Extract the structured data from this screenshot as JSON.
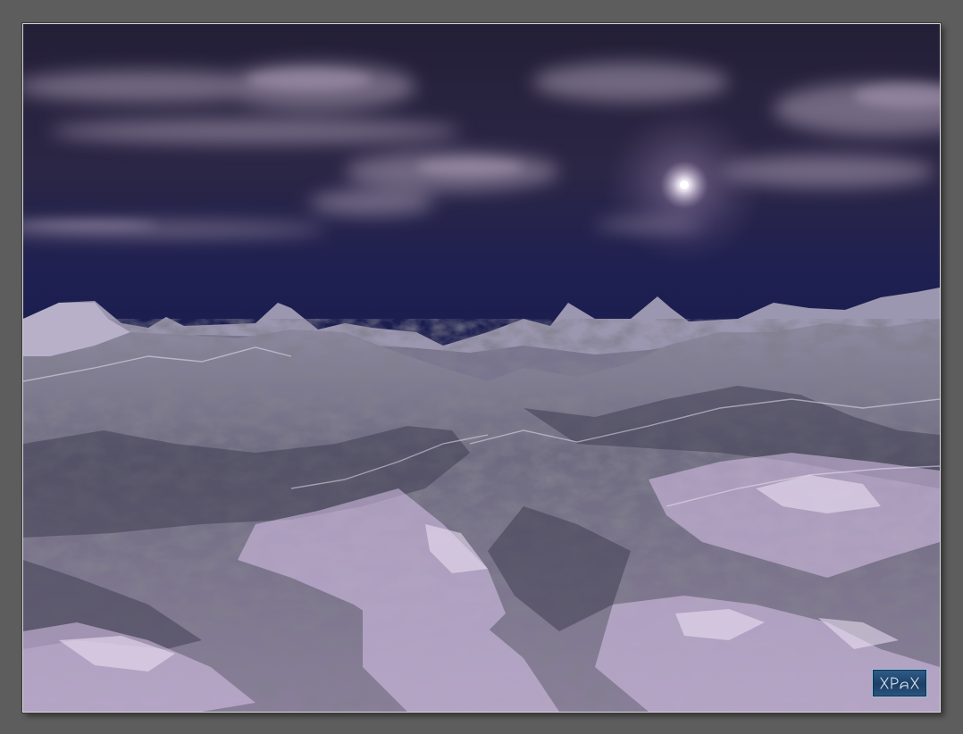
{
  "image": {
    "subject": "fractal-terrain-landscape",
    "palette": {
      "border": "#5d5d5d",
      "sky_top": "#231d36",
      "sky_horizon": "#1b1f52",
      "cloud": "#8d7f99",
      "sun": "#ffffff",
      "mountain_light": "#d8c6e6",
      "mountain_shadow": "#3b3a4c",
      "signature_blue": "#1d3f66"
    }
  },
  "signature": {
    "text": "XPaX"
  }
}
